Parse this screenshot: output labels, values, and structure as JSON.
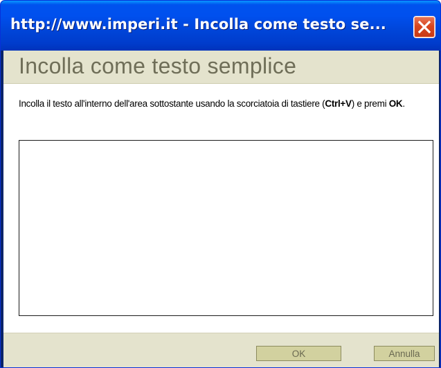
{
  "window": {
    "title": "http://www.imperi.it - Incolla come testo se..."
  },
  "dialog": {
    "heading": "Incolla come testo semplice",
    "instructions": {
      "part1": "Incolla il testo all'interno dell'area sottostante usando la scorciatoia di tastiere (",
      "shortcut": "Ctrl+V",
      "part2": ") e premi ",
      "ok_word": "OK",
      "part3": "."
    },
    "paste_area_value": ""
  },
  "buttons": {
    "ok_label": "OK",
    "cancel_label": "Annulla"
  },
  "colors": {
    "titlebar": "#0053ee",
    "header_band": "#e4e3cd",
    "heading_text": "#6f6e58",
    "button_bg": "#d2d19f",
    "close_button": "#d9461f"
  },
  "icons": {
    "close": "close-icon"
  }
}
